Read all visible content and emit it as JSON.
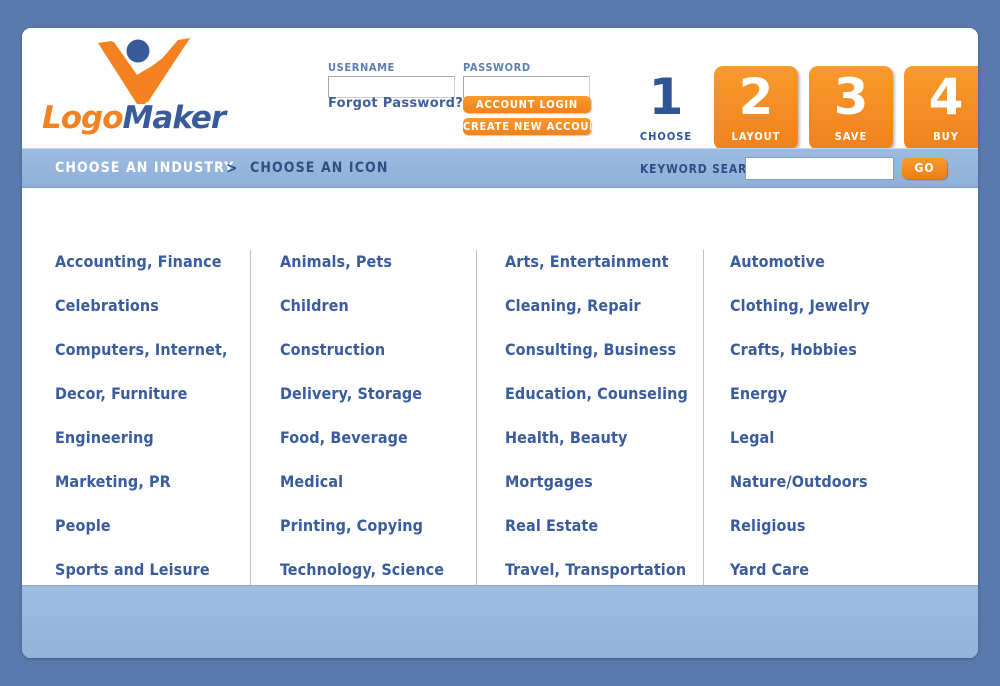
{
  "brand": {
    "name_part1": "Logo",
    "name_part2": "Maker",
    "logo_icon": "orange-checkmark-person-logo",
    "orange": "#f58220",
    "blue": "#3a5b9b"
  },
  "login": {
    "username_label": "USERNAME",
    "username_value": "",
    "username_placeholder": "",
    "password_label": "PASSWORD",
    "password_value": "",
    "password_placeholder": "",
    "forgot_password_label": "Forgot Password?",
    "account_login_label": "ACCOUNT LOGIN",
    "create_account_label": "CREATE NEW ACCOUNT"
  },
  "steps": [
    {
      "number": "1",
      "label": "CHOOSE",
      "state": "active"
    },
    {
      "number": "2",
      "label": "LAYOUT",
      "state": "inactive"
    },
    {
      "number": "3",
      "label": "SAVE",
      "state": "inactive"
    },
    {
      "number": "4",
      "label": "BUY",
      "state": "inactive"
    }
  ],
  "navbar": {
    "breadcrumb_current": "CHOOSE AN INDUSTRY",
    "breadcrumb_separator": ">",
    "breadcrumb_next": "CHOOSE AN ICON",
    "keyword_search_label": "KEYWORD SEARCH",
    "keyword_search_value": "",
    "keyword_search_placeholder": "",
    "go_label": "GO",
    "bar_color": "#95b6dd"
  },
  "industries": {
    "columns": [
      [
        "Accounting, Finance",
        "Celebrations",
        "Computers, Internet,",
        "Decor, Furniture",
        "Engineering",
        "Marketing, PR",
        "People",
        "Sports and Leisure"
      ],
      [
        "Animals, Pets",
        "Children",
        "Construction",
        "Delivery, Storage",
        "Food, Beverage",
        "Medical",
        "Printing, Copying",
        "Technology, Science"
      ],
      [
        "Arts, Entertainment",
        "Cleaning, Repair",
        "Consulting, Business",
        "Education, Counseling",
        "Health, Beauty",
        "Mortgages",
        "Real Estate",
        "Travel, Transportation"
      ],
      [
        "Automotive",
        "Clothing, Jewelry",
        "Crafts, Hobbies",
        "Energy",
        "Legal",
        "Nature/Outdoors",
        "Religious",
        "Yard Care"
      ]
    ],
    "link_color": "#3a5c9c"
  },
  "footer": {
    "band_color": "#99b9df"
  },
  "page": {
    "background_color": "#5a79ad"
  }
}
